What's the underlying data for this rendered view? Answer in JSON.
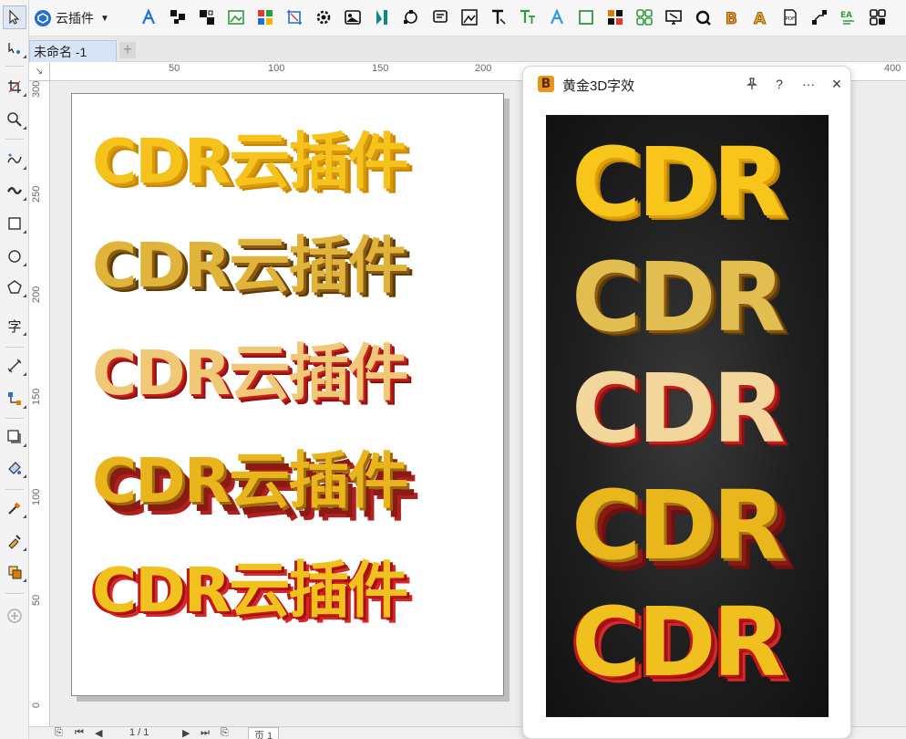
{
  "plugin_menu": {
    "label": "云插件"
  },
  "document": {
    "tab_label": "未命名 -1",
    "add_tab": "+"
  },
  "rulers": {
    "horizontal": [
      "50",
      "100",
      "150",
      "200",
      "400"
    ],
    "vertical": [
      "300",
      "250",
      "200",
      "150",
      "100",
      "50",
      "0"
    ]
  },
  "canvas_rows": [
    {
      "text": "CDR云插件",
      "style": "gold-yellow"
    },
    {
      "text": "CDR云插件",
      "style": "gold-brown"
    },
    {
      "text": "CDR云插件",
      "style": "gold-red"
    },
    {
      "text": "CDR云插件",
      "style": "gold-red-shadow"
    },
    {
      "text": "CDR云插件",
      "style": "gold-red-deep"
    }
  ],
  "docker": {
    "title": "黄金3D字效",
    "help": "?",
    "more": "···",
    "close": "×",
    "previews": [
      "CDR",
      "CDR",
      "CDR",
      "CDR",
      "CDR"
    ]
  },
  "status": {
    "page_counter": "1 / 1",
    "page_tab": "页 1"
  },
  "colors": {
    "gold": "#f5c518",
    "red": "#b01818",
    "accent": "#1f6fd6"
  }
}
